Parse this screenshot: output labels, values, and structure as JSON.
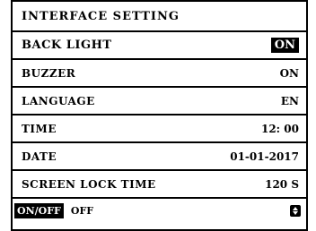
{
  "screen": {
    "title": "INTERFACE SETTING"
  },
  "settings": [
    {
      "label": "BACK LIGHT",
      "value": "ON",
      "selected": true
    },
    {
      "label": "BUZZER",
      "value": "ON",
      "selected": false
    },
    {
      "label": "LANGUAGE",
      "value": "EN",
      "selected": false
    },
    {
      "label": "TIME",
      "value": "12: 00",
      "selected": false
    },
    {
      "label": "DATE",
      "value": "01-01-2017",
      "selected": false
    },
    {
      "label": "SCREEN LOCK TIME",
      "value": "120 S",
      "selected": false
    }
  ],
  "footer": {
    "key_label": "ON/OFF",
    "key_action": "OFF",
    "nav_icon": "up-down-arrows-icon"
  }
}
